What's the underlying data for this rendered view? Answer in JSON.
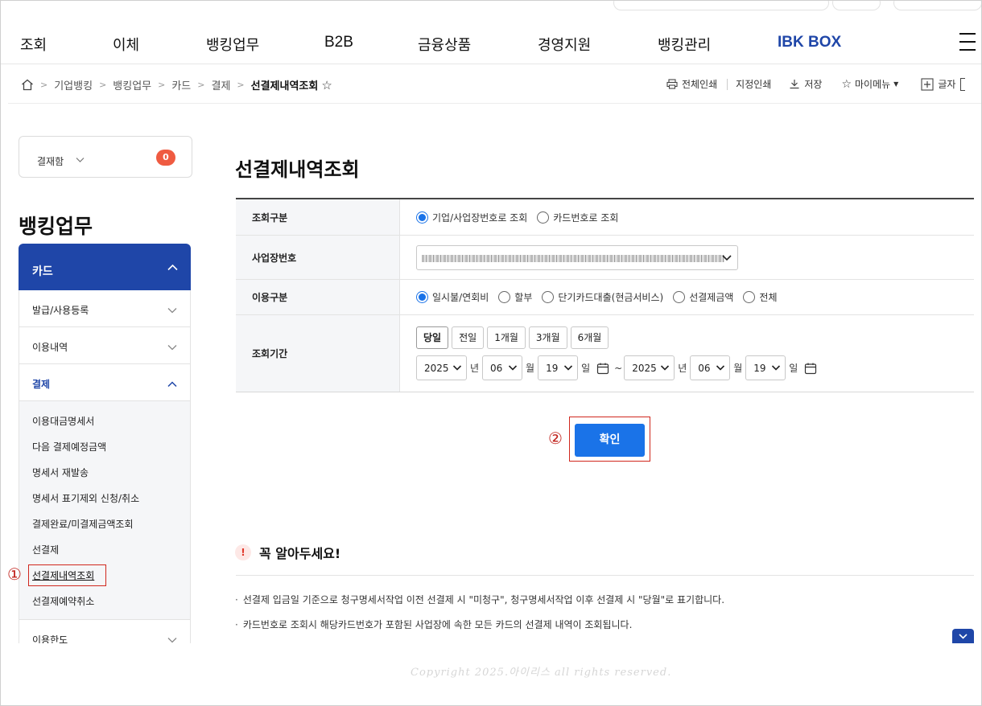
{
  "gnb": {
    "items": [
      "조회",
      "이체",
      "뱅킹업무",
      "B2B",
      "금융상품",
      "경영지원",
      "뱅킹관리",
      "IBK BOX"
    ]
  },
  "breadcrumb": {
    "items": [
      "기업뱅킹",
      "뱅킹업무",
      "카드",
      "결제"
    ],
    "current": "선결제내역조회"
  },
  "tools": {
    "print_all": "전체인쇄",
    "print_selected": "지정인쇄",
    "save": "저장",
    "my_menu": "마이메뉴",
    "font": "글자"
  },
  "inbox": {
    "label": "결재함",
    "count": "0"
  },
  "sidebar": {
    "title": "뱅킹업무",
    "head": "카드",
    "rows": [
      "발급/사용등록",
      "이용내역",
      "결제"
    ],
    "sub_items": [
      "이용대금명세서",
      "다음 결제예정금액",
      "명세서 재발송",
      "명세서 표기제외 신청/취소",
      "결제완료/미결제금액조회",
      "선결제",
      "선결제내역조회",
      "선결제예약취소"
    ],
    "after": "이용한도"
  },
  "annotations": {
    "one": "①",
    "two": "②"
  },
  "main": {
    "title": "선결제내역조회",
    "rows": {
      "inquiry_type": {
        "label": "조회구분",
        "options": [
          "기업/사업장번호로 조회",
          "카드번호로 조회"
        ],
        "selected": 0
      },
      "business_no": {
        "label": "사업장번호"
      },
      "usage_type": {
        "label": "이용구분",
        "options": [
          "일시불/연회비",
          "할부",
          "단기카드대출(현금서비스)",
          "선결제금액",
          "전체"
        ],
        "selected": 0
      },
      "period": {
        "label": "조회기간",
        "buttons": [
          "당일",
          "전일",
          "1개월",
          "3개월",
          "6개월"
        ],
        "selected": 0,
        "from": {
          "year": "2025",
          "month": "06",
          "day": "19"
        },
        "to": {
          "year": "2025",
          "month": "06",
          "day": "19"
        },
        "unit_year": "년",
        "unit_month": "월",
        "unit_day": "일",
        "tilde": "~"
      }
    },
    "confirm_label": "확인",
    "notice": {
      "title": "꼭 알아두세요!",
      "lines": [
        "선결제 입금일 기준으로 청구명세서작업 이전 선결제 시 \"미청구\", 청구명세서작업 이후 선결제 시 \"당월\"로 표기합니다.",
        "카드번호로 조회시 해당카드번호가 포함된 사업장에 속한 모든 카드의 선결제 내역이 조회됩니다."
      ]
    }
  },
  "watermark": "Copyright 2025.아이리스 all rights reserved."
}
